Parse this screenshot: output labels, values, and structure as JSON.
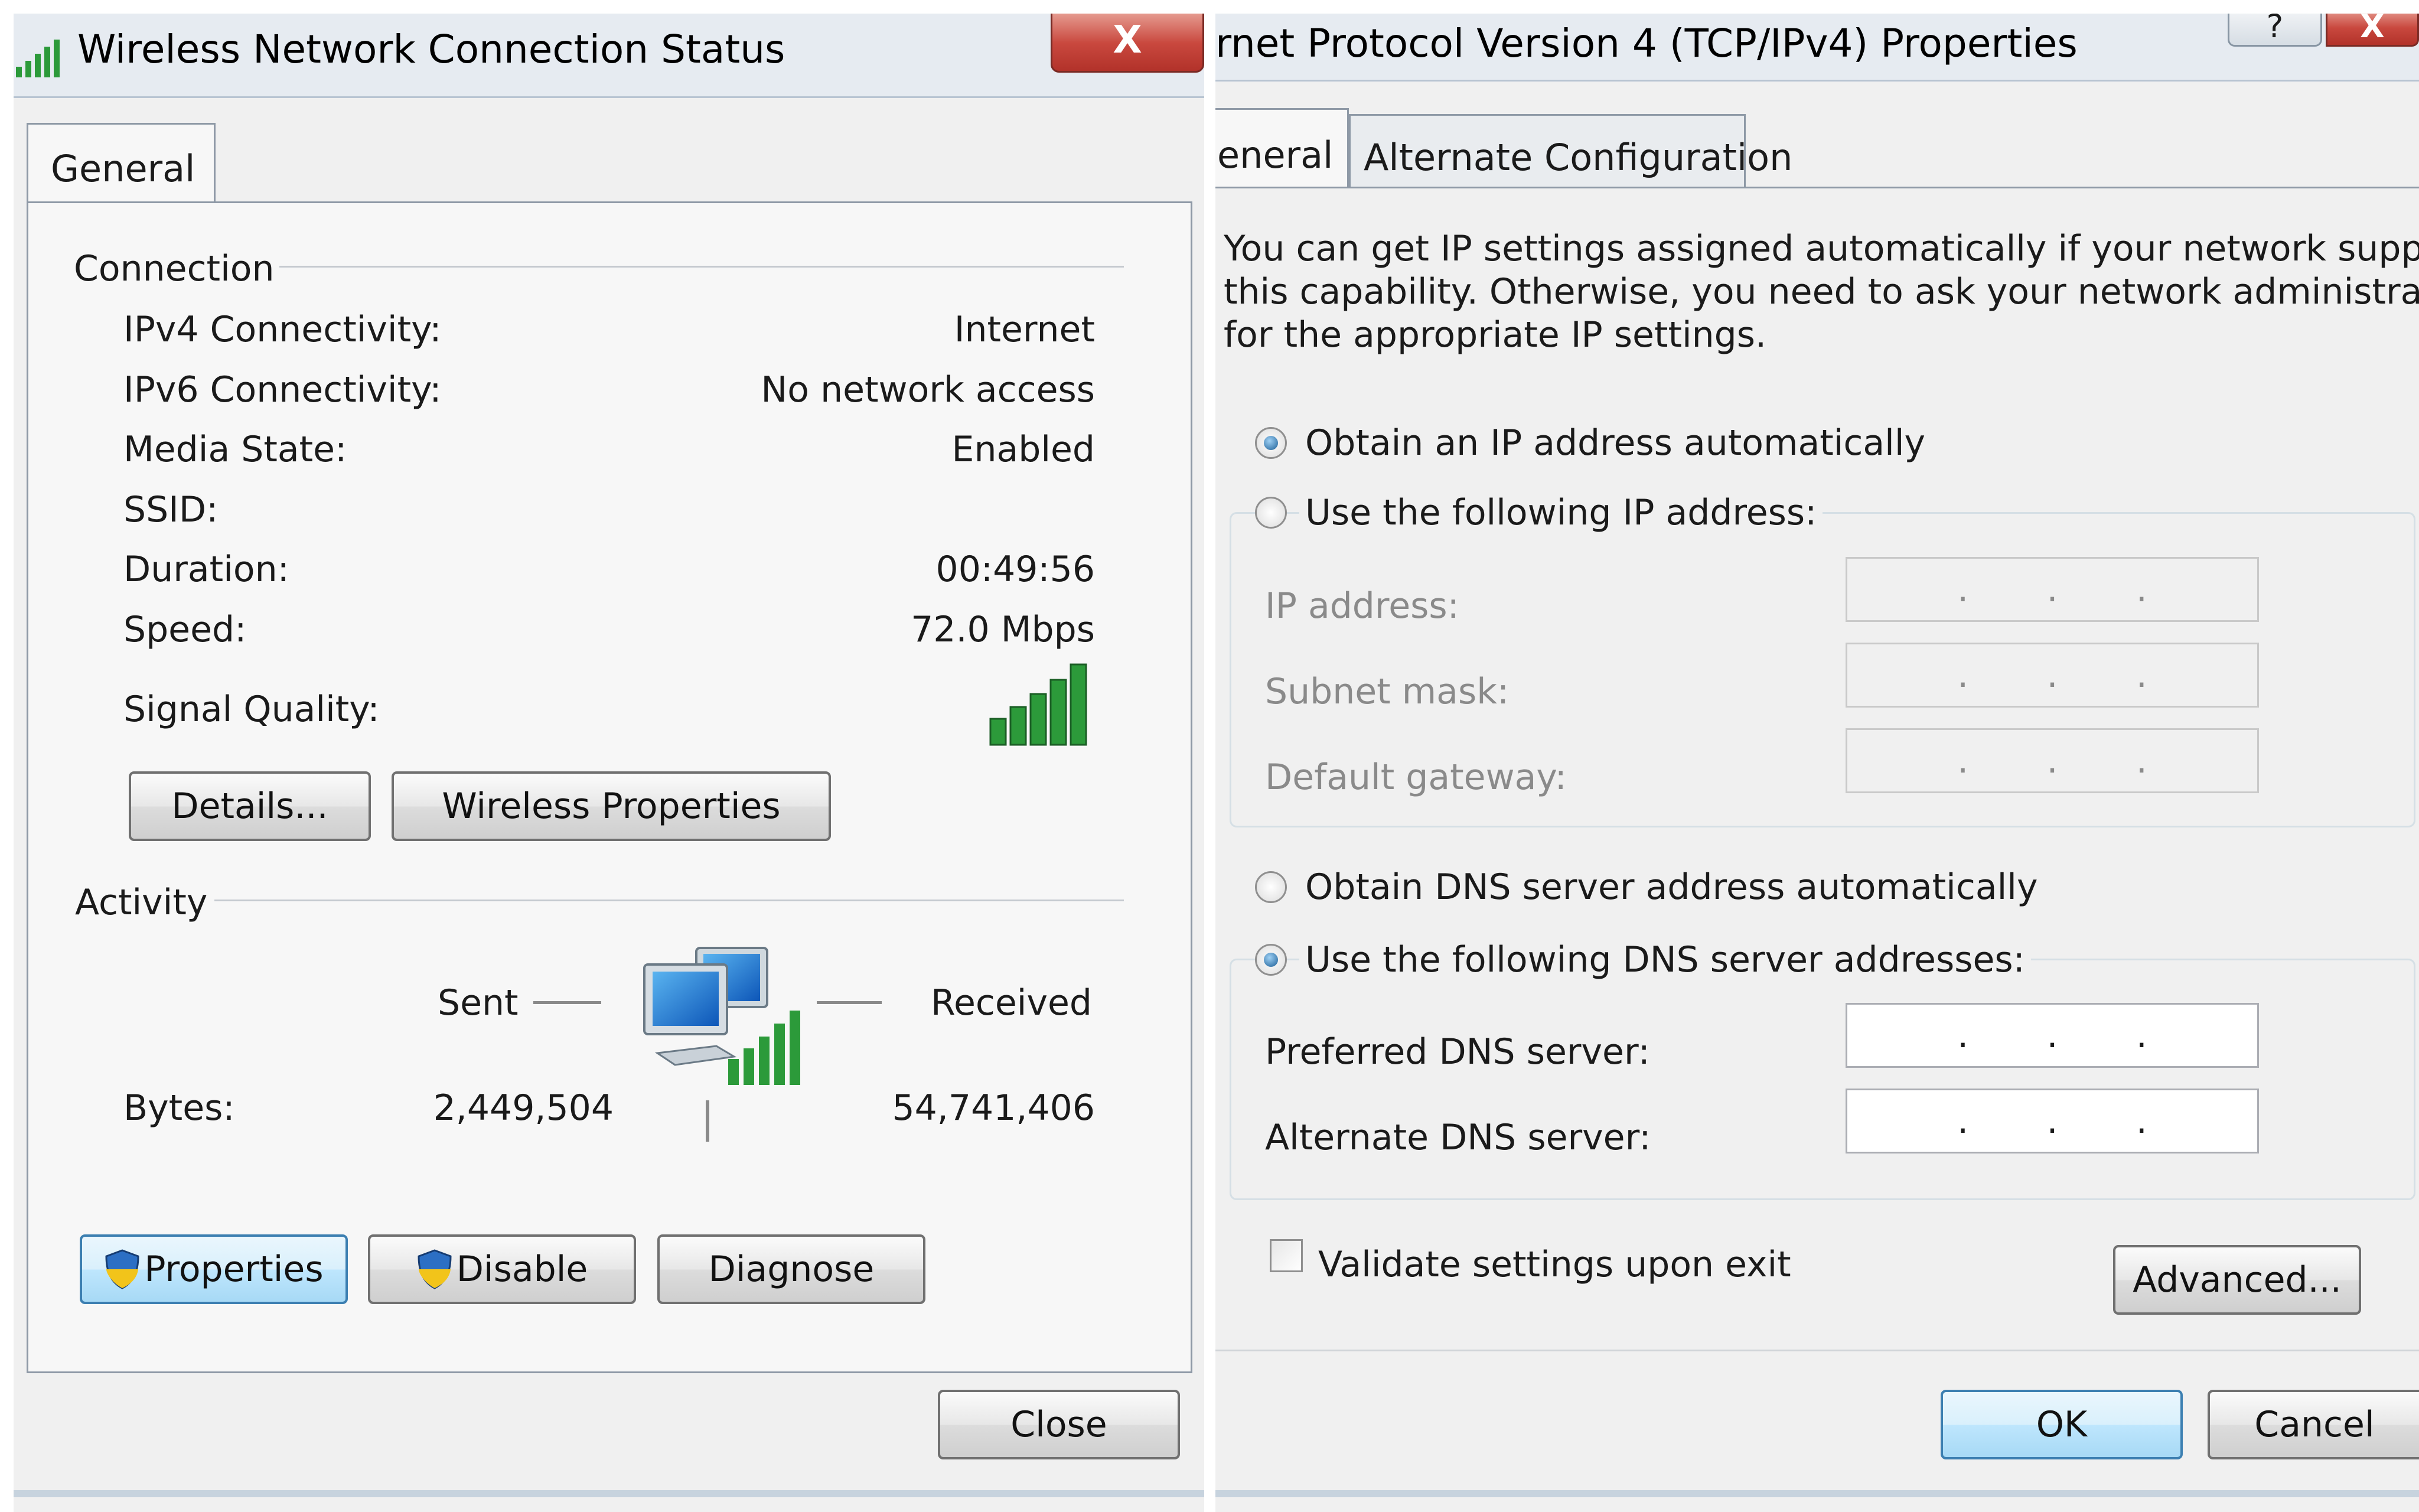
{
  "status_dialog": {
    "title": "Wireless Network Connection Status",
    "close_x": "X",
    "tab": "General",
    "connection": {
      "heading": "Connection",
      "rows": [
        {
          "label": "IPv4 Connectivity:",
          "value": "Internet"
        },
        {
          "label": "IPv6 Connectivity:",
          "value": "No network access"
        },
        {
          "label": "Media State:",
          "value": "Enabled"
        },
        {
          "label": "SSID:",
          "value": ""
        },
        {
          "label": "Duration:",
          "value": "00:49:56"
        },
        {
          "label": "Speed:",
          "value": "72.0 Mbps"
        }
      ],
      "signal_label": "Signal Quality:",
      "signal_bars": 5,
      "details_button": "Details...",
      "wireless_properties_button": "Wireless Properties"
    },
    "activity": {
      "heading": "Activity",
      "sent_label": "Sent",
      "received_label": "Received",
      "bytes_label": "Bytes:",
      "bytes_sent": "2,449,504",
      "bytes_received": "54,741,406"
    },
    "buttons": {
      "properties": "Properties",
      "disable": "Disable",
      "diagnose": "Diagnose",
      "close": "Close"
    }
  },
  "ipv4_dialog": {
    "title": "rnet Protocol Version 4 (TCP/IPv4) Properties",
    "title_help": "?",
    "title_close": "X",
    "tabs": [
      "eneral",
      "Alternate Configuration"
    ],
    "description": [
      "You can get IP settings assigned automatically if your network supports",
      "this capability. Otherwise, you need to ask your network administrator",
      "for the appropriate IP settings."
    ],
    "ip_mode": {
      "auto_label": "Obtain an IP address automatically",
      "manual_label": "Use the following IP address:",
      "selected": "auto"
    },
    "ip_fields": [
      {
        "label": "IP address:",
        "value": ". . ."
      },
      {
        "label": "Subnet mask:",
        "value": ". . ."
      },
      {
        "label": "Default gateway:",
        "value": ". . ."
      }
    ],
    "dns_mode": {
      "auto_label": "Obtain DNS server address automatically",
      "manual_label": "Use the following DNS server addresses:",
      "selected": "manual"
    },
    "dns_fields": [
      {
        "label": "Preferred DNS server:",
        "value": ". . ."
      },
      {
        "label": "Alternate DNS server:",
        "value": ". . ."
      }
    ],
    "validate_label": "Validate settings upon exit",
    "validate_checked": false,
    "advanced_button": "Advanced...",
    "ok_button": "OK",
    "cancel_button": "Cancel"
  },
  "colors": {
    "signal_green": "#2c9a3a",
    "focus_blue": "#3c7fb1",
    "close_red": "#c9483e"
  },
  "icons": [
    "signal-strength-icon",
    "network-computers-icon",
    "uac-shield-icon"
  ]
}
